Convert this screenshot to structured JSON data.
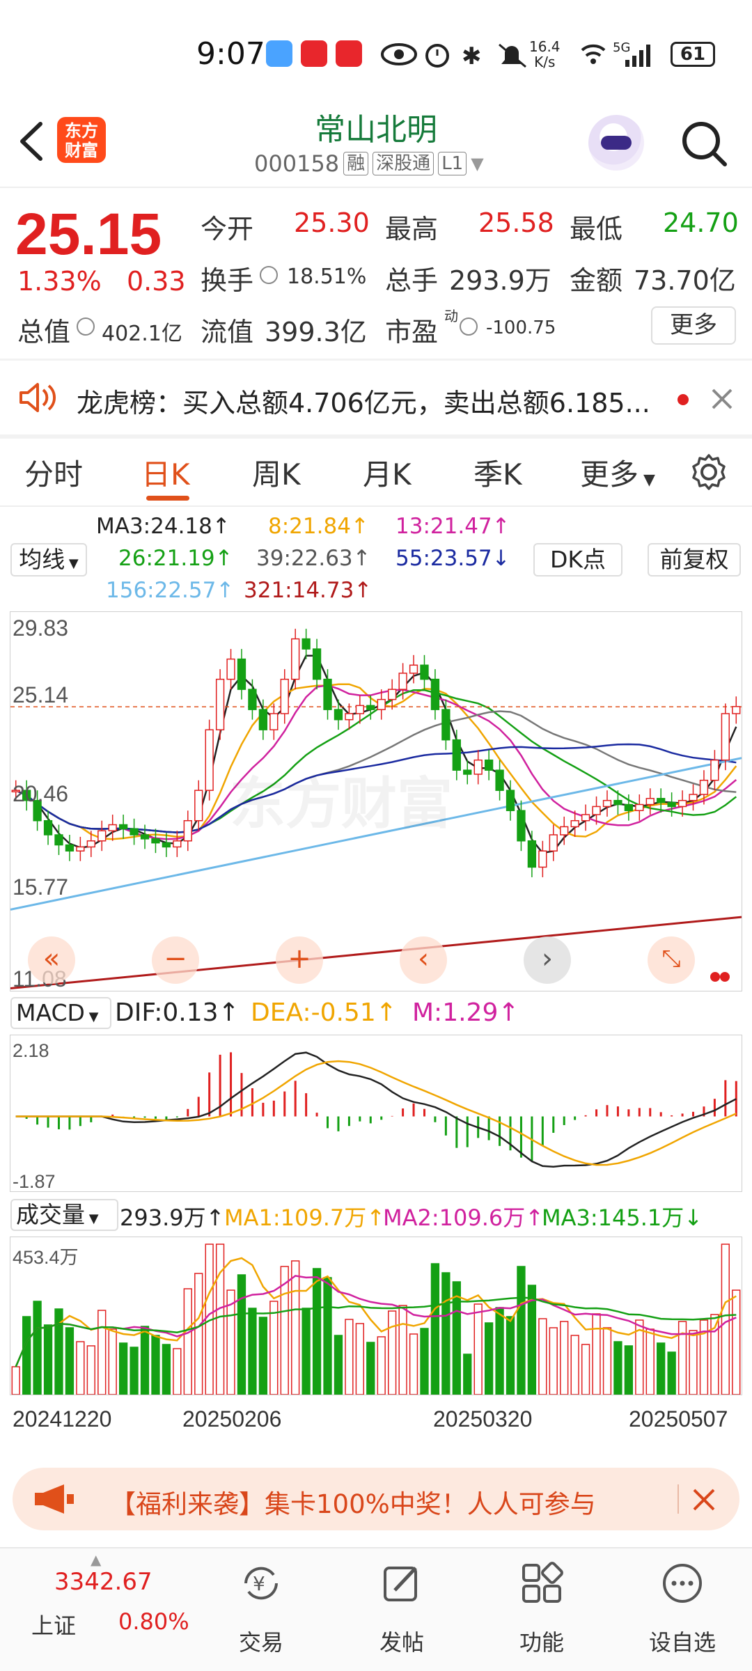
{
  "status_bar": {
    "time": "9:07",
    "net_speed_top": "16.4",
    "net_speed_bottom": "K/s",
    "signal": "5G",
    "battery": "61"
  },
  "header": {
    "logo_text_1": "东方",
    "logo_text_2": "财富",
    "stock_name": "常山北明",
    "stock_code": "000158",
    "tag_rong": "融",
    "tag_shengutong": "深股通",
    "tag_level": "L1"
  },
  "quote": {
    "price": "25.15",
    "change_pct": "1.33%",
    "change_amt": "0.33",
    "open_label": "今开",
    "open_value": "25.30",
    "high_label": "最高",
    "high_value": "25.58",
    "low_label": "最低",
    "low_value": "24.70",
    "turnover_label": "换手",
    "turnover_value": "18.51%",
    "volume_label": "总手",
    "volume_value": "293.9万",
    "amount_label": "金额",
    "amount_value": "73.70亿",
    "mktcap_label": "总值",
    "mktcap_value": "402.1亿",
    "float_label": "流值",
    "float_value": "399.3亿",
    "pe_label": "市盈",
    "pe_sup": "动",
    "pe_value": "-100.75",
    "more_label": "更多"
  },
  "ticker": {
    "text": "龙虎榜：买入总额4.706亿元，卖出总额6.185..."
  },
  "tabs": [
    "分时",
    "日K",
    "周K",
    "月K",
    "季K",
    "更多"
  ],
  "kline_legend": {
    "ma_selector": "均线",
    "ma3": "MA3:24.18↑",
    "ma8": "8:21.84↑",
    "ma13": "13:21.47↑",
    "ma26": "26:21.19↑",
    "ma39": "39:22.63↑",
    "ma55": "55:23.57↓",
    "ma156": "156:22.57↑",
    "ma321": "321:14.73↑",
    "dk_button": "DK点",
    "fq_button": "前复权"
  },
  "kline_axis": {
    "y_top": "29.83",
    "y_mid1": "25.14",
    "y_mid2": "20.46",
    "y_mid3": "15.77",
    "y_bottom": "11.08",
    "watermark": "东方财富"
  },
  "macd_legend": {
    "selector": "MACD",
    "dif": "DIF:0.13↑",
    "dea": "DEA:-0.51↑",
    "m": "M:1.29↑",
    "y_top": "2.18",
    "y_bottom": "-1.87"
  },
  "volume_legend": {
    "selector": "成交量",
    "vol": "293.9万↑",
    "ma1": "MA1:109.7万↑",
    "ma2": "MA2:109.6万↑",
    "ma3": "MA3:145.1万↓",
    "y_top": "453.4万"
  },
  "x_dates": [
    "20241220",
    "20250206",
    "20250320",
    "20250507"
  ],
  "banner": {
    "text": "【福利来袭】集卡100%中奖！人人可参与"
  },
  "bottom_nav": {
    "index_value": "3342.67",
    "index_name": "上证",
    "index_change": "0.80%",
    "trade": "交易",
    "post": "发帖",
    "function": "功能",
    "watchlist": "设自选"
  },
  "colors": {
    "up": "#e02020",
    "down": "#14a014",
    "accent": "#e0501a",
    "title_green": "#157a3a"
  },
  "chart_data": {
    "type": "candlestick",
    "y_range": [
      11.08,
      29.83
    ],
    "dates_shown": [
      "20241220",
      "20250206",
      "20250320",
      "20250507"
    ],
    "latest_close": 25.15,
    "series": [
      {
        "name": "MA3",
        "last": 24.18
      },
      {
        "name": "MA8",
        "last": 21.84
      },
      {
        "name": "MA13",
        "last": 21.47
      },
      {
        "name": "MA26",
        "last": 21.19
      },
      {
        "name": "MA39",
        "last": 22.63
      },
      {
        "name": "MA55",
        "last": 23.57
      },
      {
        "name": "MA156",
        "last": 22.57
      },
      {
        "name": "MA321",
        "last": 14.73
      }
    ],
    "macd": {
      "DIF": 0.13,
      "DEA": -0.51,
      "M": 1.29,
      "y_range": [
        -1.87,
        2.18
      ]
    },
    "volume": {
      "last": "293.9万",
      "MA1": "109.7万",
      "MA2": "109.6万",
      "MA3": "145.1万",
      "y_max": "453.4万"
    }
  }
}
